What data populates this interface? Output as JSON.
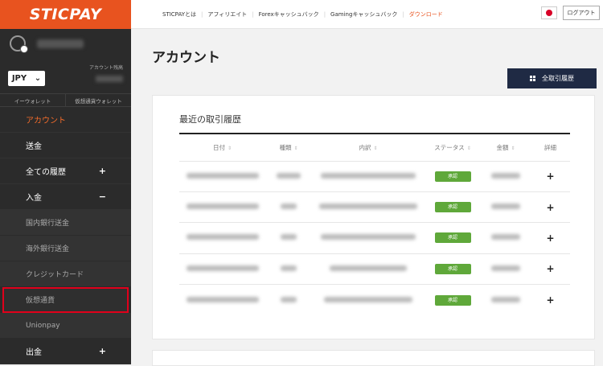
{
  "brand": {
    "logo": "STICPAY",
    "accent": "#e8531f"
  },
  "sidebar": {
    "currency": "JPY",
    "account_label": "アカウント残高",
    "wallet_tabs": [
      "イーウォレット",
      "仮想通貨ウォレット"
    ],
    "items": [
      {
        "label": "アカウント",
        "active": true,
        "sub": false,
        "expand": ""
      },
      {
        "label": "送金",
        "active": false,
        "sub": false,
        "expand": ""
      },
      {
        "label": "全ての履歴",
        "active": false,
        "sub": false,
        "expand": "+"
      },
      {
        "label": "入金",
        "active": false,
        "sub": false,
        "expand": "−"
      },
      {
        "label": "国内銀行送金",
        "active": false,
        "sub": true,
        "expand": ""
      },
      {
        "label": "海外銀行送金",
        "active": false,
        "sub": true,
        "expand": ""
      },
      {
        "label": "クレジットカード",
        "active": false,
        "sub": true,
        "expand": ""
      },
      {
        "label": "仮想通貨",
        "active": false,
        "sub": true,
        "expand": "",
        "highlighted": true
      },
      {
        "label": "Unionpay",
        "active": false,
        "sub": true,
        "expand": ""
      },
      {
        "label": "出金",
        "active": false,
        "sub": false,
        "expand": "+"
      }
    ]
  },
  "topbar": {
    "links": [
      "STICPAYとは",
      "アフィリエイト",
      "Forexキャッシュバック",
      "Gamingキャッシュバック",
      "ダウンロード"
    ],
    "logout": "ログアウト"
  },
  "main": {
    "title": "アカウント",
    "history_button": "全取引履歴",
    "card_title": "最近の取引履歴",
    "columns": [
      "日付",
      "種類",
      "内訳",
      "ステータス",
      "金額",
      "詳細"
    ],
    "rows": [
      {
        "status": "承認",
        "detail": "+"
      },
      {
        "status": "承認",
        "detail": "+"
      },
      {
        "status": "承認",
        "detail": "+"
      },
      {
        "status": "承認",
        "detail": "+"
      },
      {
        "status": "承認",
        "detail": "+"
      }
    ]
  }
}
